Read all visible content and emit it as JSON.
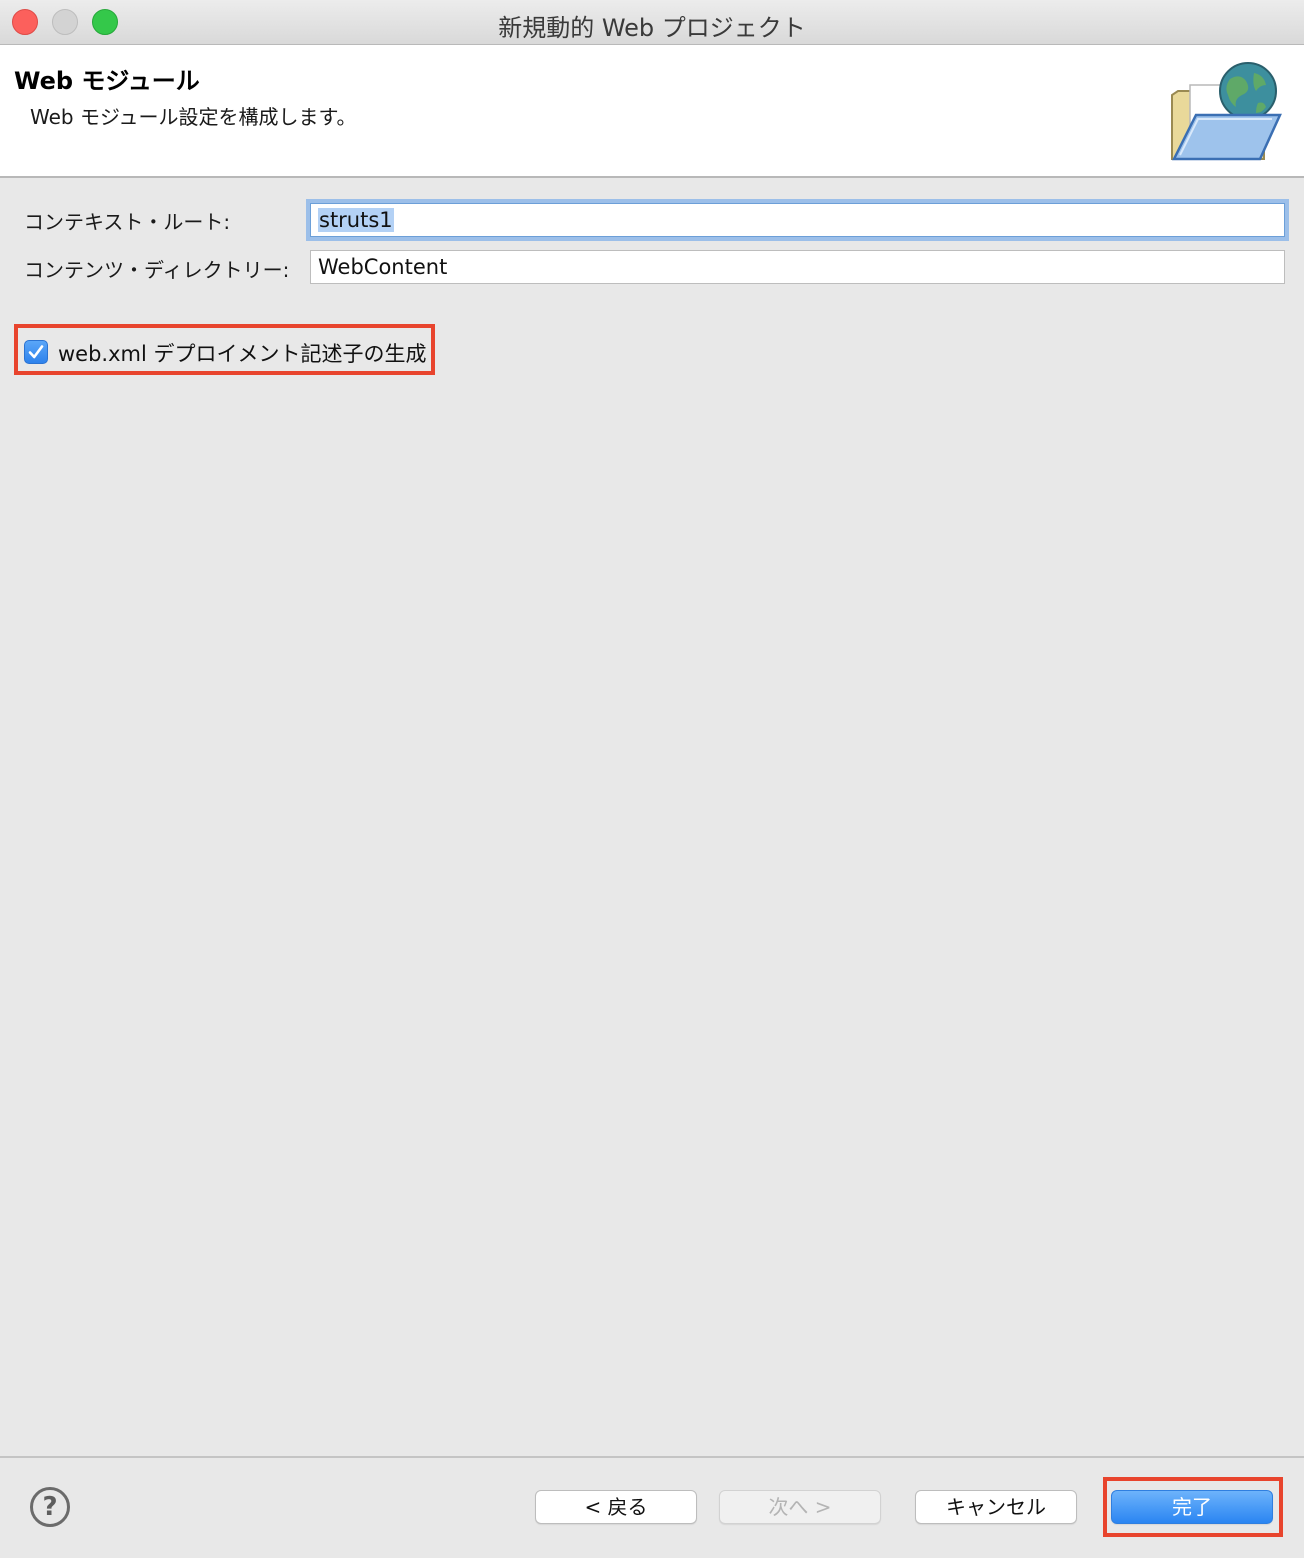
{
  "window": {
    "title": "新規動的 Web プロジェクト"
  },
  "header": {
    "title": "Web モジュール",
    "description": "Web モジュール設定を構成します。",
    "icon": "web-project-folder-globe-icon"
  },
  "form": {
    "context_root": {
      "label": "コンテキスト・ルート:",
      "value": "struts1"
    },
    "content_dir": {
      "label": "コンテンツ・ディレクトリー:",
      "value": "WebContent"
    },
    "generate_webxml": {
      "label": "web.xml デプロイメント記述子の生成",
      "checked": true
    }
  },
  "footer": {
    "help_symbol": "?",
    "back_label": "< 戻る",
    "next_label": "次へ >",
    "cancel_label": "キャンセル",
    "finish_label": "完了"
  },
  "colors": {
    "highlight": "#e8442d",
    "accent": "#2a85f2"
  }
}
